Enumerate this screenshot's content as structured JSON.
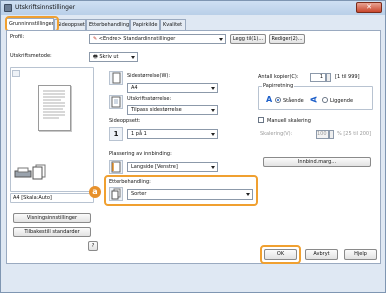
{
  "window": {
    "title": "Utskriftsinnstillinger",
    "close_glyph": "✕"
  },
  "tabs": [
    {
      "label": "Grunninnstillinger",
      "active": true
    },
    {
      "label": "Sideoppsett"
    },
    {
      "label": "Etterbehandling"
    },
    {
      "label": "Papirkilde"
    },
    {
      "label": "Kvalitet"
    }
  ],
  "profile": {
    "label": "Profil:",
    "value": "<Endre> Standardinnstillinger",
    "add_button": "Legg til(1)...",
    "edit_button": "Rediger(2)..."
  },
  "output_method": {
    "label": "Utskriftsmetode:",
    "value": "Skriv ut"
  },
  "preview": {
    "caption": "A4 [Skala:Auto]"
  },
  "left_buttons": {
    "view_settings": "Visningsinnstillinger",
    "restore_defaults": "Tilbakestill standarder",
    "help_glyph": "?"
  },
  "page_size": {
    "label": "Sidestørrelse(W):",
    "value": "A4"
  },
  "output_size": {
    "label": "Utskriftsstørrelse:",
    "value": "Tilpass sidestørrelse"
  },
  "copies": {
    "label": "Antall kopier(C):",
    "value": "1",
    "range": "[1 til 999]"
  },
  "orientation": {
    "label": "Papirretning",
    "portrait": "Stående",
    "landscape": "Liggende",
    "portrait_selected": true,
    "portrait_glyph": "A",
    "landscape_glyph": "A"
  },
  "page_layout": {
    "label": "Sideoppsett:",
    "value": "1 på 1",
    "icon_number": "1"
  },
  "manual_scaling": {
    "label": "Manuell skalering",
    "scaling_label": "Skalering(V):",
    "value": "100",
    "range": "% [25 til 200]"
  },
  "binding": {
    "label": "Plassering av innbinding:",
    "value": "Langside [Venstre]",
    "margin_button": "Innbind.marg..."
  },
  "finishing": {
    "label": "Etterbehandling:",
    "value": "Sorter"
  },
  "marker": {
    "letter": "a"
  },
  "footer": {
    "ok": "OK",
    "cancel": "Avbryt",
    "help": "Hjelp"
  },
  "accent": "#f0a030"
}
